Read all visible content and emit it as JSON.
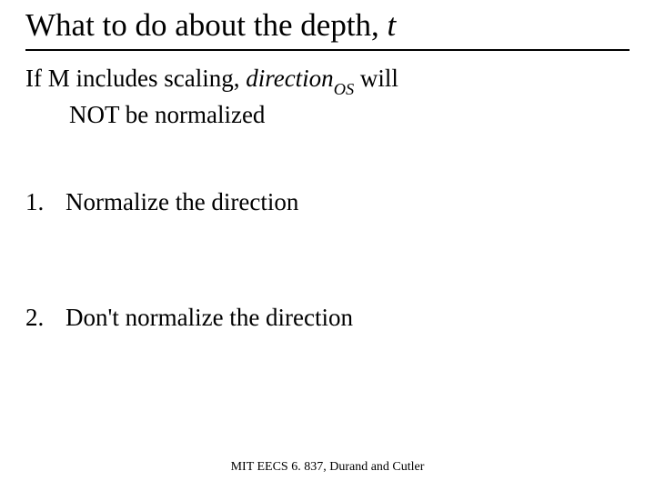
{
  "title": {
    "prefix": "What to do about the depth, ",
    "var": "t"
  },
  "intro": {
    "line1_prefix": "If  M  includes scaling, ",
    "direction_word": "direction",
    "subscript": "OS",
    "line1_suffix": " will",
    "line2": "NOT be normalized"
  },
  "items": [
    {
      "num": "1.",
      "text": "Normalize the direction"
    },
    {
      "num": "2.",
      "text": "Don't normalize the direction"
    }
  ],
  "footer": "MIT EECS 6. 837, Durand and Cutler"
}
